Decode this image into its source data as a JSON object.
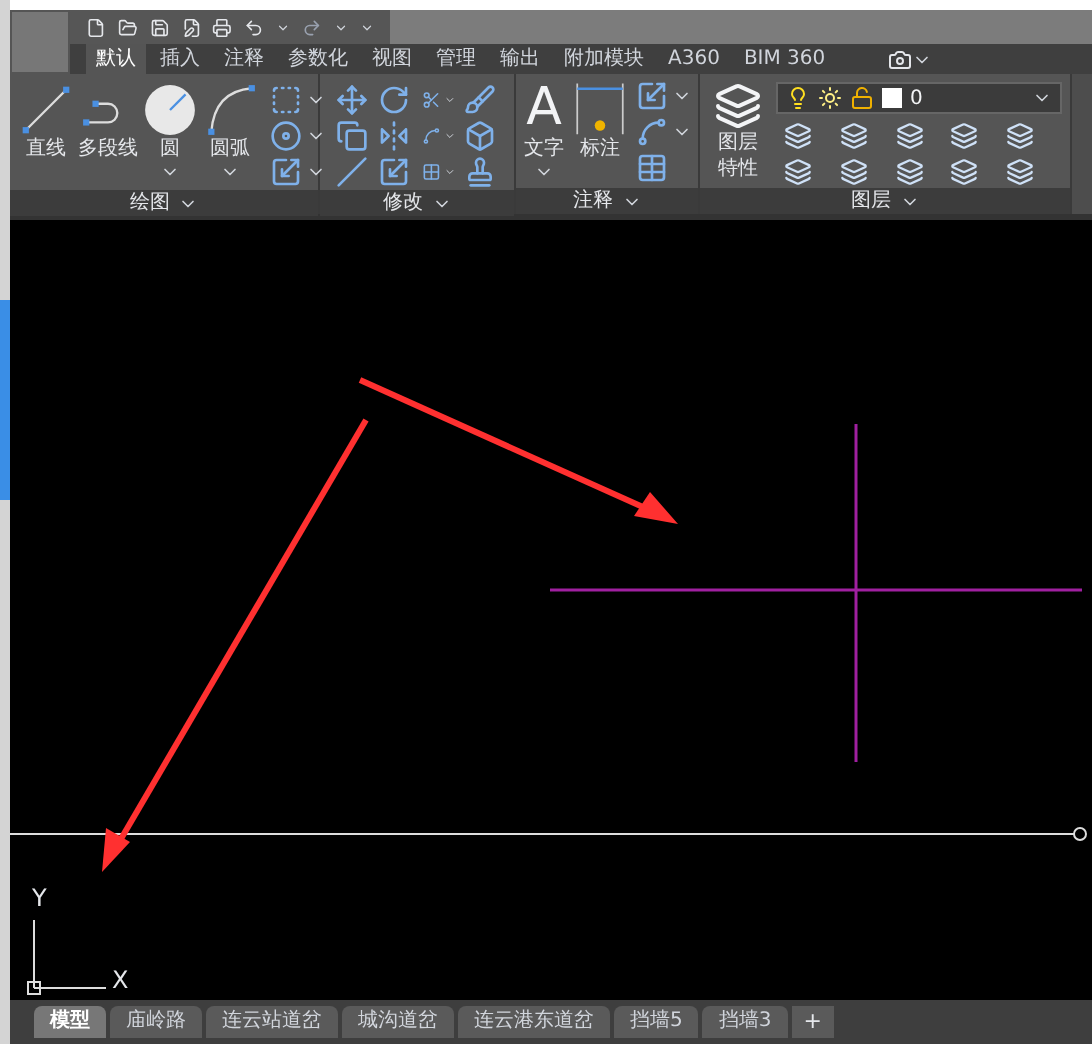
{
  "ribbon_tabs": [
    {
      "label": "默认",
      "selected": true
    },
    {
      "label": "插入",
      "selected": false
    },
    {
      "label": "注释",
      "selected": false
    },
    {
      "label": "参数化",
      "selected": false
    },
    {
      "label": "视图",
      "selected": false
    },
    {
      "label": "管理",
      "selected": false
    },
    {
      "label": "输出",
      "selected": false
    },
    {
      "label": "附加模块",
      "selected": false
    },
    {
      "label": "A360",
      "selected": false
    },
    {
      "label": "BIM 360",
      "selected": false
    }
  ],
  "draw_panel": {
    "title": "绘图",
    "tools": [
      {
        "kind": "line",
        "label": "直线"
      },
      {
        "kind": "polyline",
        "label": "多段线"
      },
      {
        "kind": "circle",
        "label": "圆"
      },
      {
        "kind": "arc",
        "label": "圆弧"
      }
    ]
  },
  "modify_panel": {
    "title": "修改"
  },
  "annotation_panel": {
    "title": "注释",
    "tools": [
      {
        "kind": "text",
        "label": "文字",
        "glyph": "A"
      },
      {
        "kind": "dimension",
        "label": "标注"
      }
    ]
  },
  "layers_panel": {
    "title": "图层",
    "properties_label": [
      "图层",
      "特性"
    ],
    "current_layer": "0"
  },
  "ucs": {
    "x_label": "X",
    "y_label": "Y"
  },
  "layout_tabs": [
    {
      "label": "模型",
      "selected": true
    },
    {
      "label": "庙岭路",
      "selected": false
    },
    {
      "label": "连云站道岔",
      "selected": false
    },
    {
      "label": "城沟道岔",
      "selected": false
    },
    {
      "label": "连云港东道岔",
      "selected": false
    },
    {
      "label": "挡墙5",
      "selected": false
    },
    {
      "label": "挡墙3",
      "selected": false
    }
  ],
  "add_tab": "+"
}
